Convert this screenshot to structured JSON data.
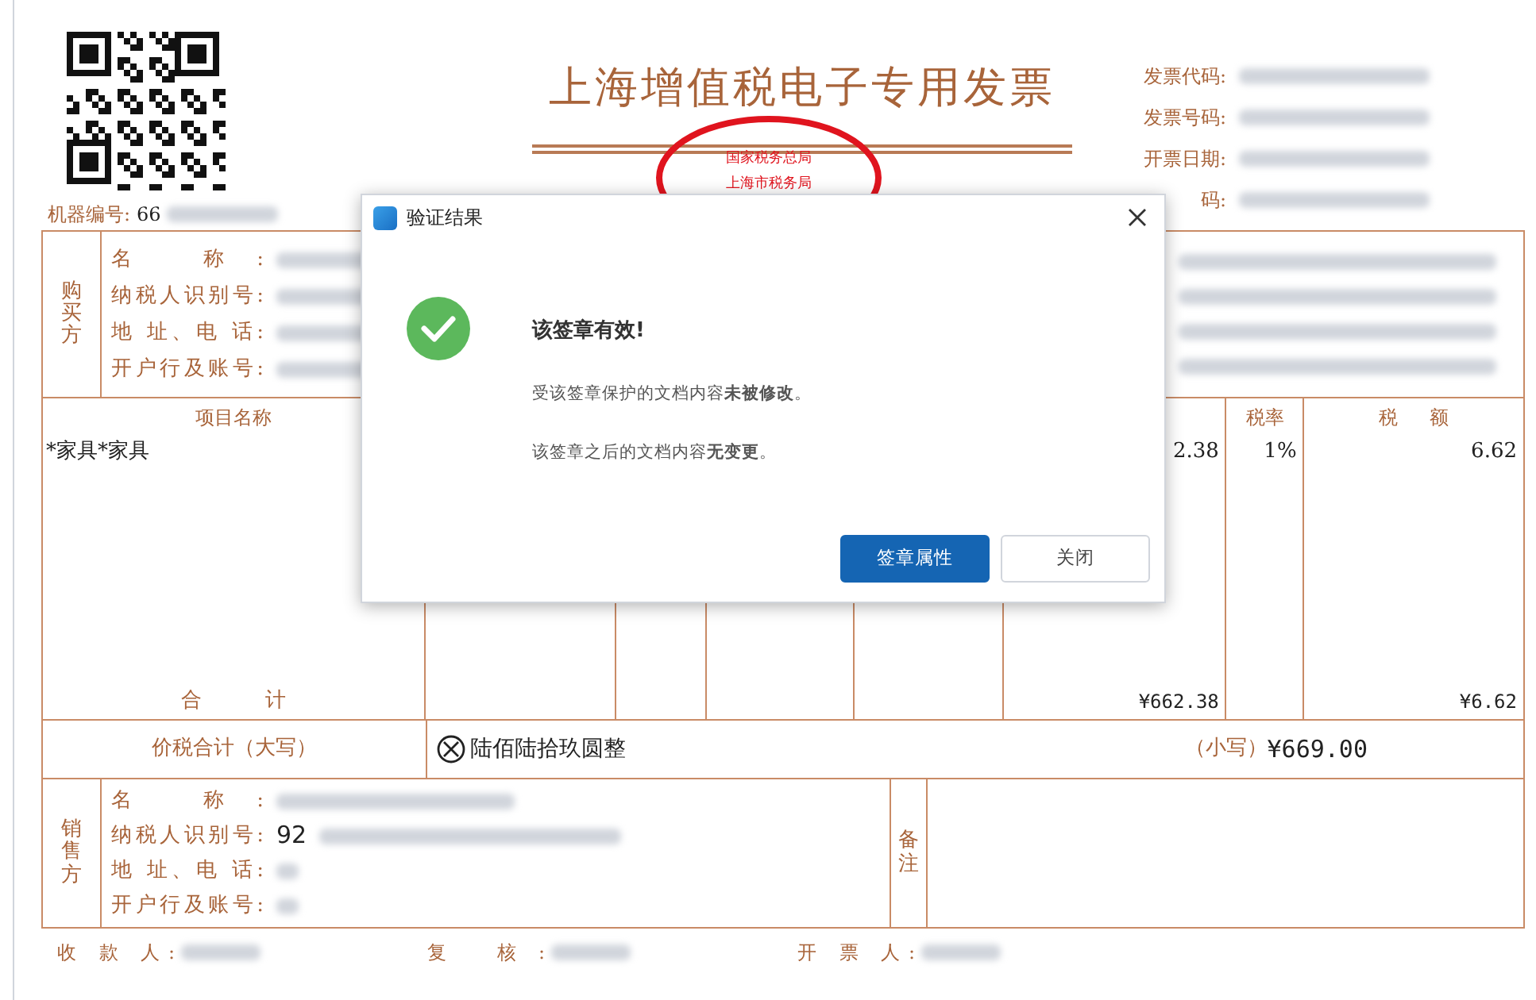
{
  "invoice": {
    "title": "上海增值税电子专用发票",
    "machine_no": {
      "label": "机器编号:",
      "value": "66"
    },
    "meta": [
      {
        "label": "发票代码:"
      },
      {
        "label": "发票号码:"
      },
      {
        "label": "开票日期:"
      },
      {
        "label": "码:"
      }
    ],
    "seal": {
      "lines": [
        "国家税务总局",
        "上海市税务局"
      ]
    },
    "buyer": {
      "side_label": "购买方",
      "fields": [
        "名 称:",
        "纳税人识别号:",
        "地 址、电 话:",
        "开户行及账号:"
      ]
    },
    "items": {
      "columns": [
        {
          "label": "项目名称"
        },
        {
          "label": "税率"
        },
        {
          "label": "税 额"
        }
      ],
      "rows": [
        {
          "name": "*家具*家具",
          "amount": "2.38",
          "tax_rate": "1%",
          "tax": "6.62"
        }
      ],
      "total": {
        "label": "合 计",
        "amount": "¥662.38",
        "tax": "¥6.62"
      }
    },
    "grand_total": {
      "label": "价税合计（大写）",
      "words": "陆佰陆拾玖圆整",
      "small_label": "（小写）",
      "figure": "¥669.00"
    },
    "seller": {
      "side_label": "销售方",
      "fields": [
        {
          "label": "名 称:"
        },
        {
          "label": "纳税人识别号:",
          "value": "92"
        },
        {
          "label": "地 址、电 话:"
        },
        {
          "label": "开户行及账号:"
        }
      ]
    },
    "notes_label": "备注",
    "signatures": [
      "收 款 人:",
      "复 核:",
      "开 票 人:"
    ]
  },
  "dialog": {
    "title": "验证结果",
    "heading": "该签章有效!",
    "lines": [
      "受该签章保护的文档内容**未被修改**。",
      "该签章之后的文档内容**无变更**。"
    ],
    "buttons": [
      {
        "label": "签章属性",
        "kind": "primary"
      },
      {
        "label": "关闭",
        "kind": "secondary"
      }
    ]
  }
}
